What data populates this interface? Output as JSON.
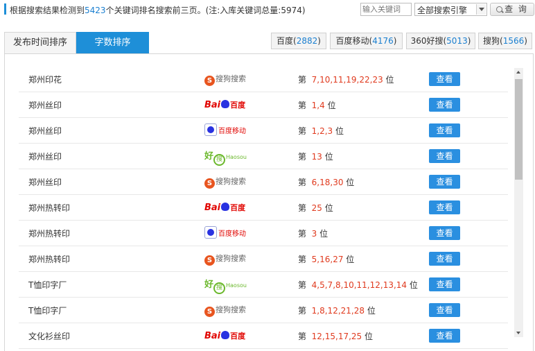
{
  "header": {
    "text_before": "根据搜索结果检测到",
    "count": "5423",
    "text_after": "个关键词排名搜索前三页。(注:入库关键词总量:5974)",
    "search_placeholder": "输入关键词",
    "engine_select": "全部搜索引擎",
    "search_button": "查 询"
  },
  "tabs": [
    {
      "label": "发布时间排序",
      "active": false
    },
    {
      "label": "字数排序",
      "active": true
    }
  ],
  "engines": [
    {
      "name": "百度",
      "count": "2882"
    },
    {
      "name": "百度移动",
      "count": "4176"
    },
    {
      "name": "360好搜",
      "count": "5013"
    },
    {
      "name": "搜狗",
      "count": "1566"
    }
  ],
  "rank_prefix": "第",
  "rank_suffix": "位",
  "view_label": "查看",
  "logos": {
    "sogou": {
      "mark": "S",
      "text": "搜狗搜索"
    },
    "baidu": {
      "left": "Bai",
      "right": "百度"
    },
    "baidu_mobile": {
      "text": "百度移动"
    },
    "haosou": {
      "hao": "好",
      "sou": "搜",
      "en": "Haosou"
    }
  },
  "rows": [
    {
      "keyword": "郑州印花",
      "engine": "sogou",
      "positions": "7,10,11,19,22,23"
    },
    {
      "keyword": "郑州丝印",
      "engine": "baidu",
      "positions": "1,4"
    },
    {
      "keyword": "郑州丝印",
      "engine": "baidu_mobile",
      "positions": "1,2,3"
    },
    {
      "keyword": "郑州丝印",
      "engine": "haosou",
      "positions": "13"
    },
    {
      "keyword": "郑州丝印",
      "engine": "sogou",
      "positions": "6,18,30"
    },
    {
      "keyword": "郑州热转印",
      "engine": "baidu",
      "positions": "25"
    },
    {
      "keyword": "郑州热转印",
      "engine": "baidu_mobile",
      "positions": "3"
    },
    {
      "keyword": "郑州热转印",
      "engine": "sogou",
      "positions": "5,16,27"
    },
    {
      "keyword": "T恤印字厂",
      "engine": "haosou",
      "positions": "4,5,7,8,10,11,12,13,14"
    },
    {
      "keyword": "T恤印字厂",
      "engine": "sogou",
      "positions": "1,8,12,21,28"
    },
    {
      "keyword": "文化衫丝印",
      "engine": "baidu",
      "positions": "12,15,17,25"
    }
  ]
}
